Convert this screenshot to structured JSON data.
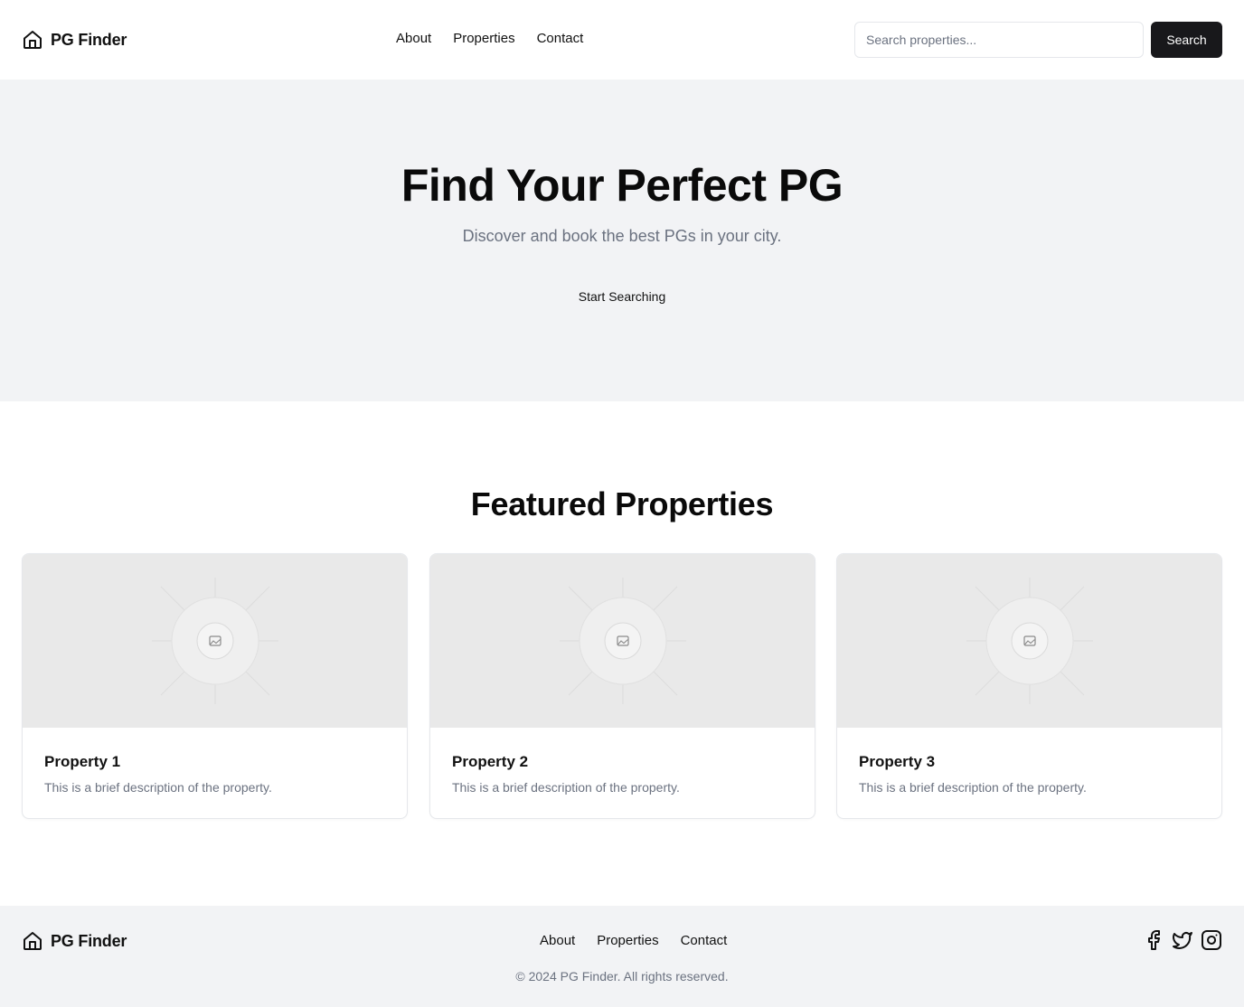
{
  "header": {
    "brand_name": "PG Finder",
    "brand_icon": "house-icon",
    "nav": [
      {
        "label": "About"
      },
      {
        "label": "Properties"
      },
      {
        "label": "Contact"
      }
    ],
    "search": {
      "placeholder": "Search properties...",
      "value": "",
      "button_label": "Search"
    }
  },
  "hero": {
    "title": "Find Your Perfect PG",
    "subtitle": "Discover and book the best PGs in your city.",
    "cta_label": "Start Searching"
  },
  "featured": {
    "title": "Featured Properties",
    "cards": [
      {
        "title": "Property 1",
        "description": "This is a brief description of the property.",
        "image_icon": "image-placeholder-icon"
      },
      {
        "title": "Property 2",
        "description": "This is a brief description of the property.",
        "image_icon": "image-placeholder-icon"
      },
      {
        "title": "Property 3",
        "description": "This is a brief description of the property.",
        "image_icon": "image-placeholder-icon"
      }
    ]
  },
  "footer": {
    "brand_name": "PG Finder",
    "nav": [
      {
        "label": "About"
      },
      {
        "label": "Properties"
      },
      {
        "label": "Contact"
      }
    ],
    "copyright": "© 2024 PG Finder. All rights reserved.",
    "socials": [
      "facebook-icon",
      "twitter-icon",
      "instagram-icon"
    ]
  },
  "colors": {
    "primary_button": "#18181b",
    "hero_background": "#f2f3f5",
    "muted_text": "#6b7280",
    "card_image_background": "#e9e9e9"
  }
}
